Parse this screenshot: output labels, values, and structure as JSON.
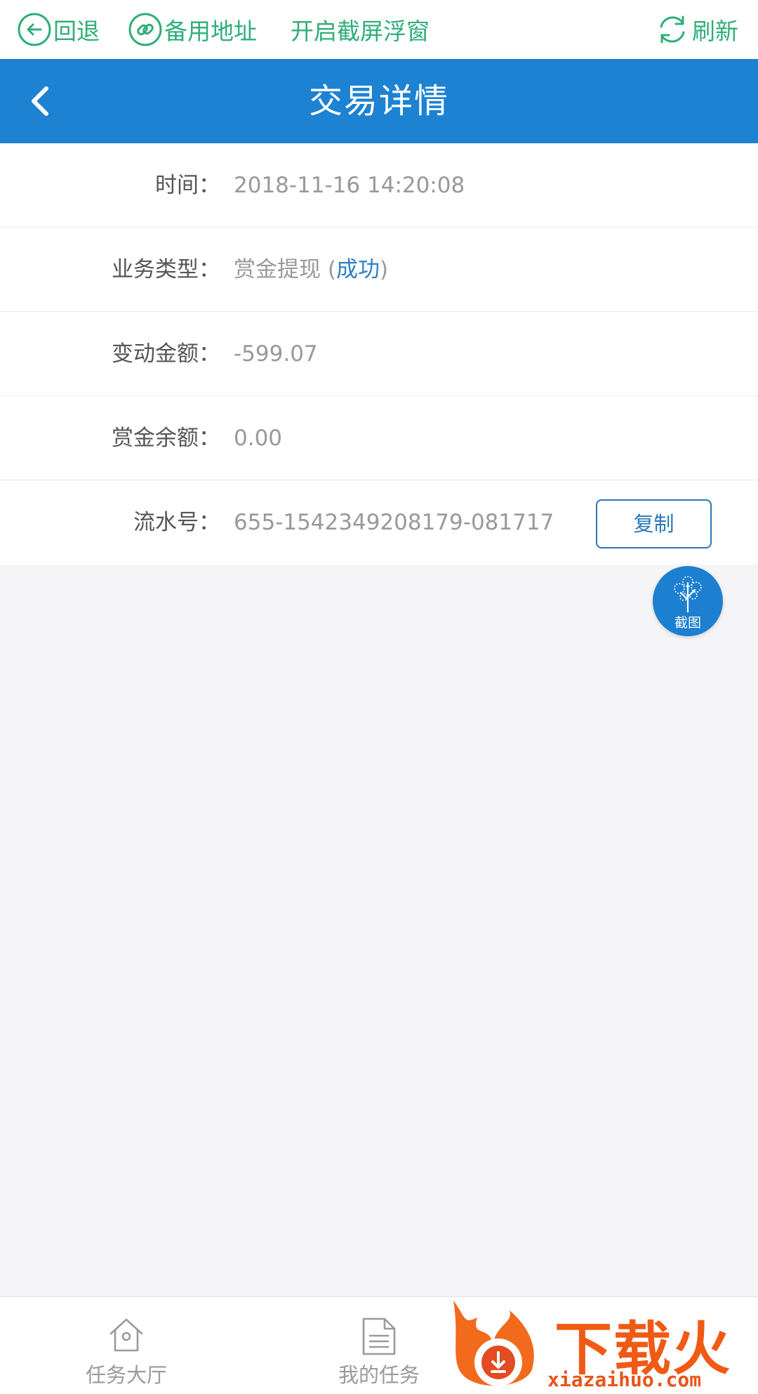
{
  "util_bar": {
    "back_label": "回退",
    "backup_label": "备用地址",
    "float_label": "开启截屏浮窗",
    "refresh_label": "刷新"
  },
  "header": {
    "title": "交易详情"
  },
  "details": {
    "time_label": "时间：",
    "time_value": "2018-11-16 14:20:08",
    "type_label": "业务类型：",
    "type_value": "赏金提现 (",
    "type_status": "成功",
    "type_close": ")",
    "amount_label": "变动金额：",
    "amount_value": "-599.07",
    "balance_label": "赏金余额：",
    "balance_value": "0.00",
    "serial_label": "流水号：",
    "serial_value": "655-1542349208179-081717",
    "copy_label": "复制"
  },
  "float_button": {
    "label": "截图"
  },
  "bottom_nav": {
    "items": [
      {
        "label": "任务大厅",
        "icon": "home-icon"
      },
      {
        "label": "我的任务",
        "icon": "document-icon"
      }
    ]
  },
  "watermark": {
    "brand": "下载火",
    "url": "xiazaihuo.com"
  },
  "colors": {
    "accent": "#1e82d2",
    "util_green": "#2fae78",
    "status_blue": "#2d7fc4",
    "watermark_orange": "#f05a14"
  }
}
